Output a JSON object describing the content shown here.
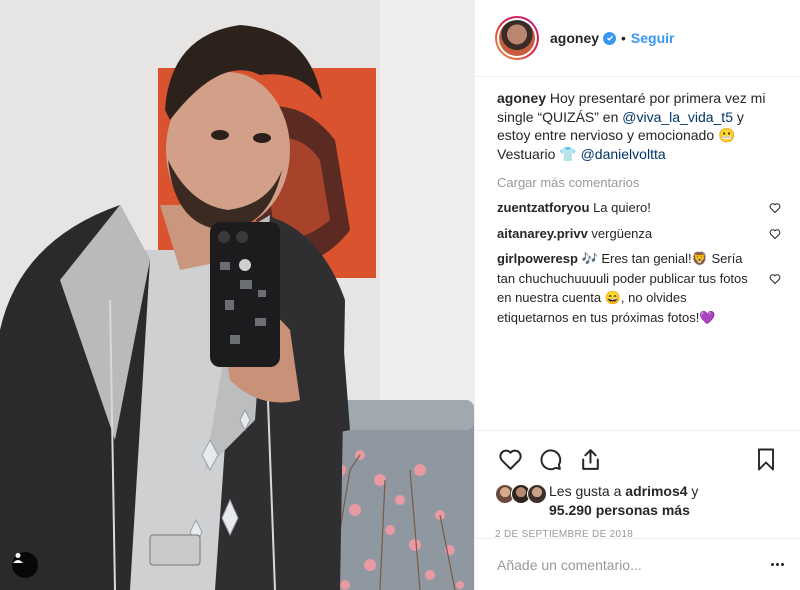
{
  "post": {
    "username": "agoney",
    "verified": true,
    "separator": "•",
    "follow_label": "Seguir",
    "caption": {
      "username": "agoney",
      "text_1": " Hoy presentaré por primera vez mi single “QUIZÁS” en ",
      "mention_1": "@viva_la_vida_t5",
      "text_2": " y estoy entre nervioso y emocionado 😬 Vestuario 👕 ",
      "mention_2": "@danielvoltta"
    },
    "load_more_label": "Cargar más comentarios",
    "comments": [
      {
        "username": "zuentzatforyou",
        "text": " La quiero!"
      },
      {
        "username": "aitanarey.privv",
        "text": " vergüenza"
      },
      {
        "username": "girlpoweresp",
        "text": " 🎶 Eres tan genial!🦁 Sería tan chuchuchuuuuli poder publicar tus fotos en nuestra cuenta 😄, no olvides etiquetarnos en tus próximas fotos!💜"
      }
    ],
    "likes": {
      "prefix": "Les gusta a ",
      "user": "adrimos4",
      "middle": " y",
      "count": "95.290",
      "suffix": " personas más"
    },
    "date": "2 de septiembre de 2018",
    "add_comment_placeholder": "Añade un comentario..."
  },
  "colors": {
    "link": "#3897f0",
    "mention": "#003569",
    "muted": "#999999",
    "text": "#262626",
    "wall": "#e8e6e4",
    "poster": "#d9532f"
  },
  "icons": [
    "heart-icon",
    "comment-icon",
    "share-icon",
    "bookmark-icon",
    "verified-icon",
    "user-tag-icon",
    "more-options-icon"
  ]
}
